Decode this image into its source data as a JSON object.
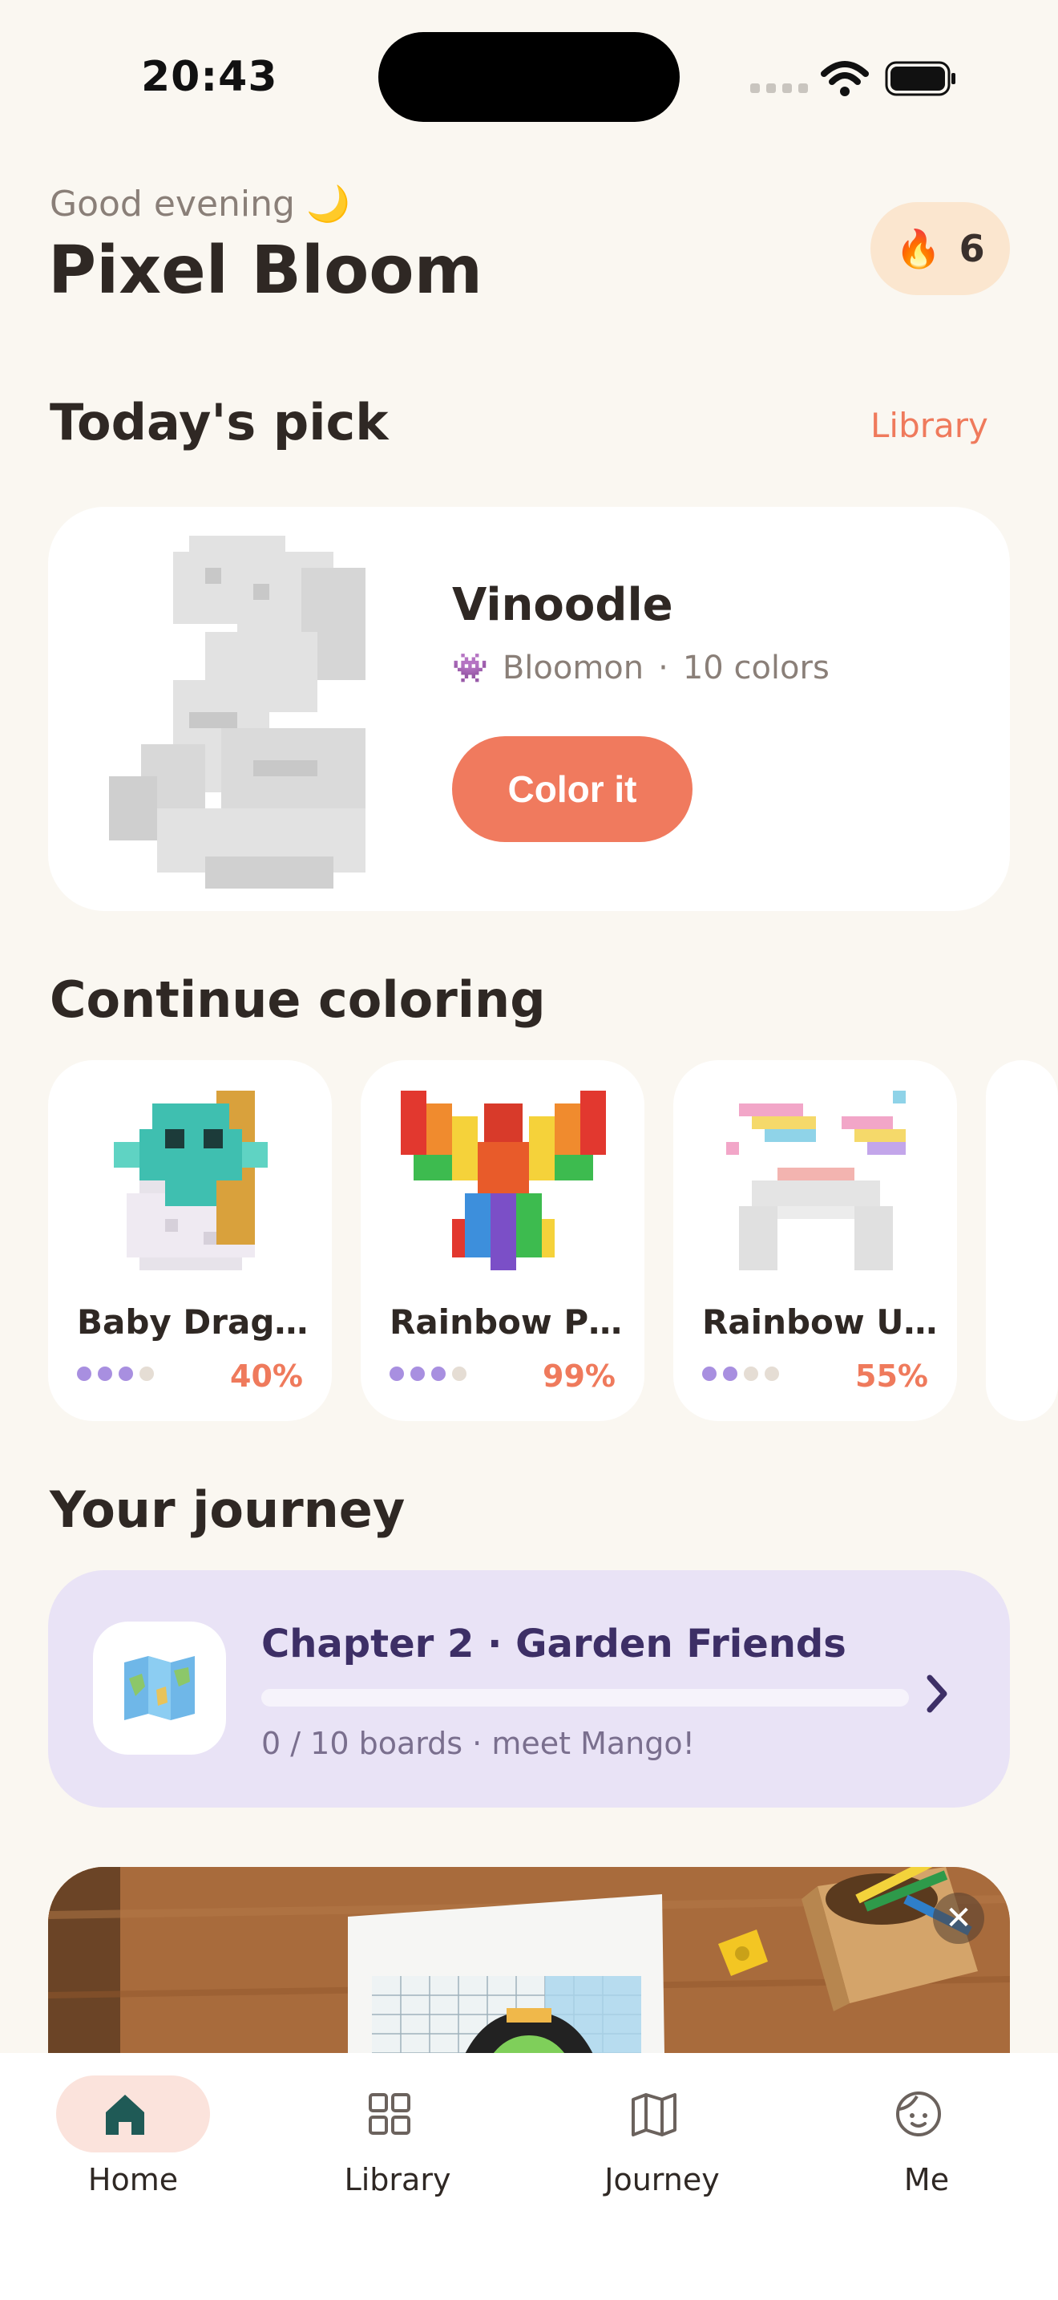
{
  "status": {
    "time": "20:43"
  },
  "header": {
    "greeting": "Good evening 🌙",
    "title": "Pixel Bloom",
    "streak_count": "6",
    "streak_icon": "flame-icon"
  },
  "todays_pick": {
    "section_title": "Today's pick",
    "library_link": "Library",
    "name": "Vinoodle",
    "category_icon": "👾",
    "category": "Bloomon",
    "separator": "·",
    "colors": "10 colors",
    "button": "Color it"
  },
  "continue": {
    "section_title": "Continue coloring",
    "items": [
      {
        "name": "Baby Drag…",
        "progress": "40%",
        "dots_filled": 3,
        "dots_total": 4
      },
      {
        "name": "Rainbow P…",
        "progress": "99%",
        "dots_filled": 3,
        "dots_total": 4
      },
      {
        "name": "Rainbow U…",
        "progress": "55%",
        "dots_filled": 2,
        "dots_total": 4
      }
    ]
  },
  "journey": {
    "section_title": "Your journey",
    "chapter": "Chapter 2 · Garden Friends",
    "progress_text": "0 / 10 boards · meet Mango!",
    "progress_fraction": 0,
    "icon": "map-icon"
  },
  "tabs": [
    {
      "label": "Home",
      "icon": "home-icon",
      "active": true
    },
    {
      "label": "Library",
      "icon": "grid-icon",
      "active": false
    },
    {
      "label": "Journey",
      "icon": "map-icon",
      "active": false
    },
    {
      "label": "Me",
      "icon": "face-icon",
      "active": false
    }
  ],
  "colors": {
    "accent": "#f07a5e",
    "background": "#faf7f1",
    "journey_bg": "#e9e3f6",
    "dot_on": "#a88fe0"
  }
}
